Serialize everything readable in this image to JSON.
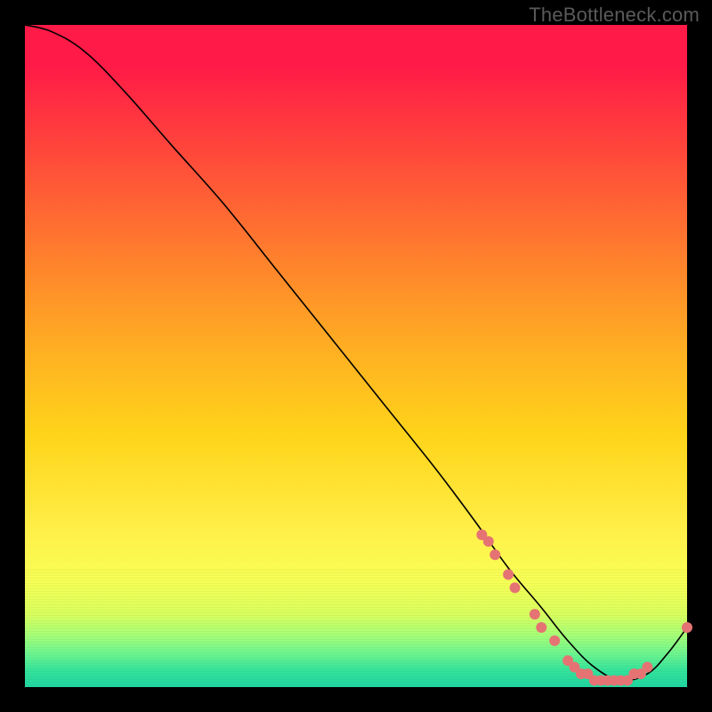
{
  "watermark": "TheBottleneck.com",
  "chart_data": {
    "type": "line",
    "title": "",
    "xlabel": "",
    "ylabel": "",
    "xlim": [
      0,
      100
    ],
    "ylim": [
      0,
      100
    ],
    "grid": false,
    "legend": false,
    "background_gradient": {
      "orientation": "vertical",
      "stops": [
        {
          "pos": 0,
          "color": "#ff1a47"
        },
        {
          "pos": 20,
          "color": "#ff4a3a"
        },
        {
          "pos": 38,
          "color": "#ff8a2a"
        },
        {
          "pos": 50,
          "color": "#ffb222"
        },
        {
          "pos": 62,
          "color": "#ffd41a"
        },
        {
          "pos": 77,
          "color": "#fff04a"
        },
        {
          "pos": 89,
          "color": "#d9ff5e"
        },
        {
          "pos": 95,
          "color": "#6cf58f"
        },
        {
          "pos": 100,
          "color": "#1fd6a0"
        }
      ]
    },
    "series": [
      {
        "name": "bottleneck-curve",
        "color": "#000000",
        "stroke_width": 1.6,
        "x": [
          0,
          4,
          9,
          15,
          22,
          30,
          38,
          46,
          54,
          62,
          68,
          73,
          78,
          82,
          86,
          90,
          94,
          97,
          100
        ],
        "y": [
          100,
          99,
          96,
          90,
          82,
          73,
          63,
          53,
          43,
          33,
          25,
          18,
          12,
          7,
          3,
          1,
          2,
          5,
          9
        ]
      }
    ],
    "markers": {
      "name": "highlight-dots",
      "color": "#e57373",
      "radius": 6,
      "points": [
        {
          "x": 69,
          "y": 23
        },
        {
          "x": 70,
          "y": 22
        },
        {
          "x": 71,
          "y": 20
        },
        {
          "x": 73,
          "y": 17
        },
        {
          "x": 74,
          "y": 15
        },
        {
          "x": 77,
          "y": 11
        },
        {
          "x": 78,
          "y": 9
        },
        {
          "x": 80,
          "y": 7
        },
        {
          "x": 82,
          "y": 4
        },
        {
          "x": 83,
          "y": 3
        },
        {
          "x": 84,
          "y": 2
        },
        {
          "x": 85,
          "y": 2
        },
        {
          "x": 86,
          "y": 1
        },
        {
          "x": 87,
          "y": 1
        },
        {
          "x": 88,
          "y": 1
        },
        {
          "x": 89,
          "y": 1
        },
        {
          "x": 90,
          "y": 1
        },
        {
          "x": 91,
          "y": 1
        },
        {
          "x": 92,
          "y": 2
        },
        {
          "x": 93,
          "y": 2
        },
        {
          "x": 94,
          "y": 3
        },
        {
          "x": 100,
          "y": 9
        }
      ]
    }
  }
}
